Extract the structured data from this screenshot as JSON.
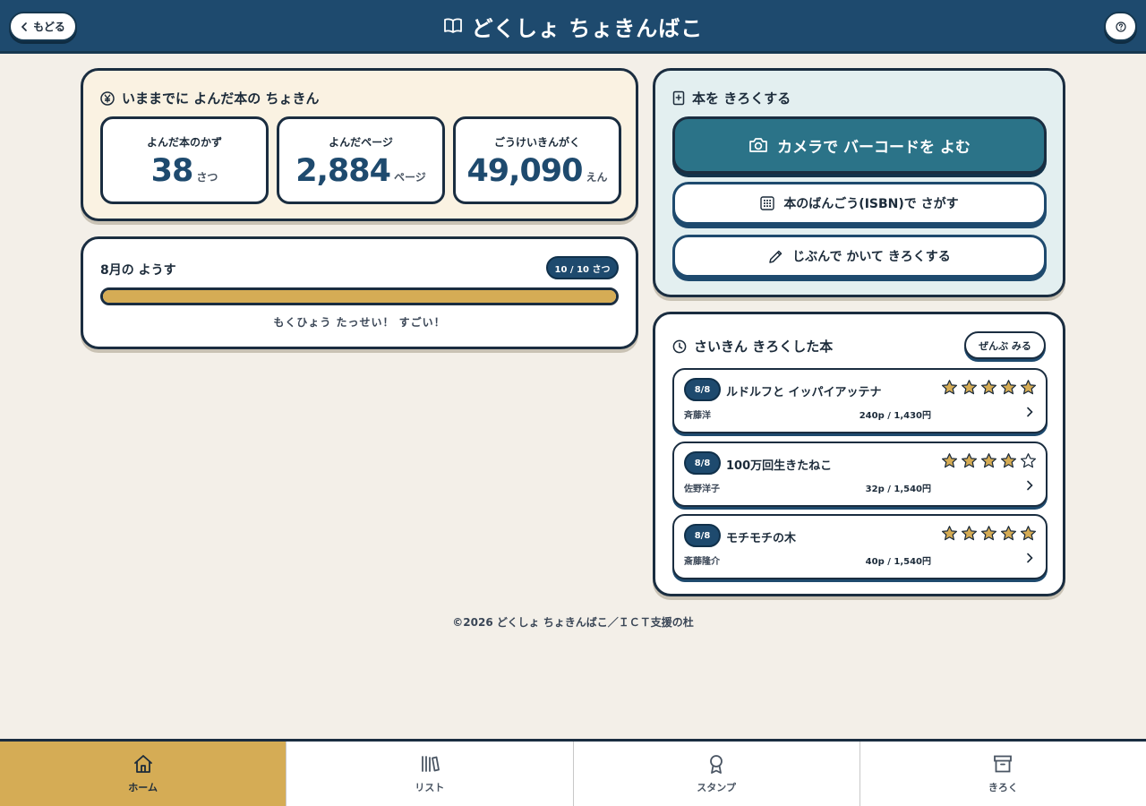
{
  "header": {
    "back_label": "もどる",
    "title": "どくしょ ちょきんばこ",
    "title_icon": "book-open-icon",
    "help_icon": "help-icon"
  },
  "savings": {
    "title": "いままでに よんだ本の ちょきん",
    "icon": "yen-icon",
    "stats": [
      {
        "label": "よんだ本のかず",
        "value": "38",
        "unit": "さつ"
      },
      {
        "label": "よんだページ",
        "value": "2,884",
        "unit": "ページ"
      },
      {
        "label": "ごうけいきんがく",
        "value": "49,090",
        "unit": "えん"
      }
    ]
  },
  "month": {
    "title": "8月の ようす",
    "badge": "10 / 10 さつ",
    "progress": 1.0,
    "message": "もくひょう たっせい！ すごい！",
    "bar_color": "#d5ac55"
  },
  "record": {
    "title": "本を きろくする",
    "camera_button": "カメラで バーコードを よむ",
    "isbn_button": "本のばんごう(ISBN)で さがす",
    "manual_button": "じぶんで かいて きろくする"
  },
  "recent": {
    "title": "さいきん きろくした本",
    "all_button": "ぜんぶ みる",
    "books": [
      {
        "date": "8/8",
        "title": "ルドルフと イッパイアッテナ",
        "author": "斉藤洋",
        "stats": "240p / 1,430円",
        "rating": 5
      },
      {
        "date": "8/8",
        "title": "100万回生きたねこ",
        "author": "佐野洋子",
        "stats": "32p / 1,540円",
        "rating": 4
      },
      {
        "date": "8/8",
        "title": "モチモチの木",
        "author": "斎藤隆介",
        "stats": "40p / 1,540円",
        "rating": 5
      }
    ]
  },
  "footer": "©2026 どくしょ ちょきんばこ／ＩＣＴ支援の杜",
  "nav": [
    {
      "label": "ホーム",
      "icon": "home-icon",
      "active": true
    },
    {
      "label": "リスト",
      "icon": "books-icon",
      "active": false
    },
    {
      "label": "スタンプ",
      "icon": "award-icon",
      "active": false
    },
    {
      "label": "きろく",
      "icon": "archive-icon",
      "active": false
    }
  ],
  "colors": {
    "header_bg": "#1e4a6e",
    "accent_teal": "#2b7388",
    "accent_gold": "#d5ac55",
    "page_bg": "#f3efe8"
  }
}
